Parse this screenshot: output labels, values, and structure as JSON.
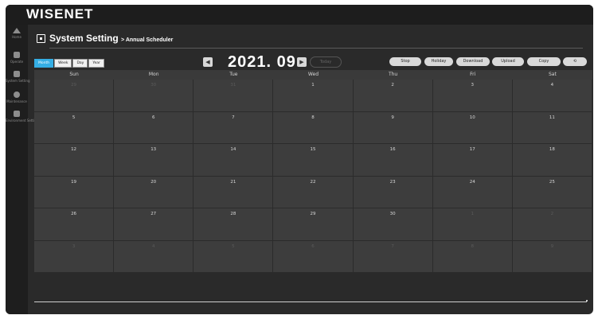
{
  "app": {
    "logo": "WISENET"
  },
  "sidebar": {
    "items": [
      {
        "label": "Home",
        "icon": "home-icon"
      },
      {
        "label": "Operate",
        "icon": "operate-icon"
      },
      {
        "label": "System Setting",
        "icon": "system-setting-icon"
      },
      {
        "label": "Maintenance",
        "icon": "maintenance-icon"
      },
      {
        "label": "Environment Setting",
        "icon": "environment-setting-icon"
      }
    ]
  },
  "header": {
    "title": "System Setting",
    "breadcrumb": "> Annual Scheduler"
  },
  "view_tabs": [
    {
      "label": "Month",
      "active": true
    },
    {
      "label": "Week",
      "active": false
    },
    {
      "label": "Day",
      "active": false
    },
    {
      "label": "Year",
      "active": false
    }
  ],
  "calendar_nav": {
    "prev": "◀",
    "title": "2021. 09",
    "next": "▶",
    "today": "Today"
  },
  "actions": [
    {
      "label": "Stop",
      "name": "stop-button"
    },
    {
      "label": "Holiday",
      "name": "holiday-button"
    },
    {
      "label": "Download",
      "name": "download-button"
    },
    {
      "label": "Upload",
      "name": "upload-button"
    },
    {
      "label": "Copy",
      "name": "copy-button"
    },
    {
      "label": "⟲",
      "name": "refresh-button"
    }
  ],
  "calendar": {
    "weekdays": [
      "Sun",
      "Mon",
      "Tue",
      "Wed",
      "Thu",
      "Fri",
      "Sat"
    ],
    "weeks": [
      [
        {
          "d": "29",
          "o": true
        },
        {
          "d": "30",
          "o": true
        },
        {
          "d": "31",
          "o": true
        },
        {
          "d": "1"
        },
        {
          "d": "2"
        },
        {
          "d": "3"
        },
        {
          "d": "4"
        }
      ],
      [
        {
          "d": "5"
        },
        {
          "d": "6"
        },
        {
          "d": "7"
        },
        {
          "d": "8"
        },
        {
          "d": "9"
        },
        {
          "d": "10"
        },
        {
          "d": "11"
        }
      ],
      [
        {
          "d": "12"
        },
        {
          "d": "13"
        },
        {
          "d": "14"
        },
        {
          "d": "15"
        },
        {
          "d": "16"
        },
        {
          "d": "17"
        },
        {
          "d": "18"
        }
      ],
      [
        {
          "d": "19"
        },
        {
          "d": "20"
        },
        {
          "d": "21"
        },
        {
          "d": "22"
        },
        {
          "d": "23"
        },
        {
          "d": "24"
        },
        {
          "d": "25"
        }
      ],
      [
        {
          "d": "26"
        },
        {
          "d": "27"
        },
        {
          "d": "28"
        },
        {
          "d": "29"
        },
        {
          "d": "30"
        },
        {
          "d": "1",
          "o": true
        },
        {
          "d": "2",
          "o": true
        }
      ],
      [
        {
          "d": "3",
          "o": true
        },
        {
          "d": "4",
          "o": true
        },
        {
          "d": "5",
          "o": true
        },
        {
          "d": "6",
          "o": true
        },
        {
          "d": "7",
          "o": true
        },
        {
          "d": "8",
          "o": true
        },
        {
          "d": "9",
          "o": true
        }
      ]
    ]
  },
  "colors": {
    "accent": "#35aee4",
    "background": "#2a2a2a",
    "cell": "#3d3d3d"
  }
}
